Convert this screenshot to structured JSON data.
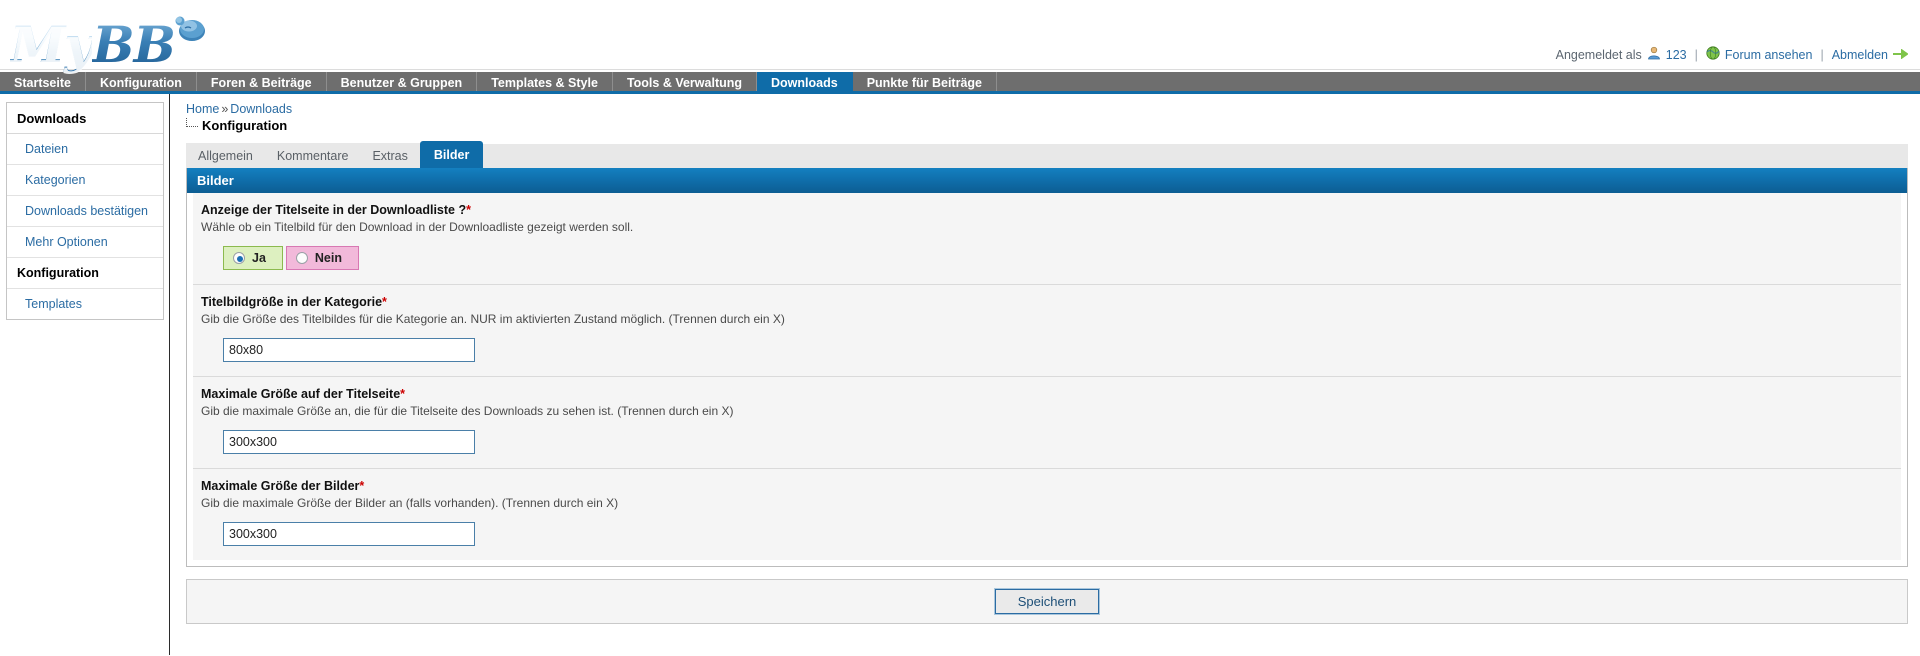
{
  "brand": {
    "my": "My",
    "bb": "BB",
    "bubble_icon": "speech-bubble-icon"
  },
  "userbar": {
    "logged_in_label": "Angemeldet als",
    "user_icon": "user-icon",
    "username": "123",
    "separator": "|",
    "globe_icon": "globe-icon",
    "forum_link": "Forum ansehen",
    "logout_link": "Abmelden",
    "logout_arrow_icon": "arrow-right-icon"
  },
  "nav": {
    "items": [
      {
        "label": "Startseite",
        "active": false
      },
      {
        "label": "Konfiguration",
        "active": false
      },
      {
        "label": "Foren & Beiträge",
        "active": false
      },
      {
        "label": "Benutzer & Gruppen",
        "active": false
      },
      {
        "label": "Templates & Style",
        "active": false
      },
      {
        "label": "Tools & Verwaltung",
        "active": false
      },
      {
        "label": "Downloads",
        "active": true
      },
      {
        "label": "Punkte für Beiträge",
        "active": false
      }
    ]
  },
  "sidebar": {
    "heading": "Downloads",
    "items": [
      {
        "label": "Dateien",
        "current": false
      },
      {
        "label": "Kategorien",
        "current": false
      },
      {
        "label": "Downloads bestätigen",
        "current": false
      },
      {
        "label": "Mehr Optionen",
        "current": false
      },
      {
        "label": "Konfiguration",
        "current": true
      },
      {
        "label": "Templates",
        "current": false
      }
    ]
  },
  "breadcrumb": {
    "home": "Home",
    "chevron": "»",
    "section": "Downloads",
    "current": "Konfiguration"
  },
  "tabs": [
    {
      "label": "Allgemein",
      "active": false
    },
    {
      "label": "Kommentare",
      "active": false
    },
    {
      "label": "Extras",
      "active": false
    },
    {
      "label": "Bilder",
      "active": true
    }
  ],
  "panel": {
    "title": "Bilder",
    "fields": [
      {
        "label": "Anzeige der Titelseite in der Downloadliste ?",
        "required": "*",
        "description": "Wähle ob ein Titelbild für den Download in der Downloadliste gezeigt werden soll.",
        "type": "radio",
        "options": [
          {
            "label": "Ja",
            "selected": true
          },
          {
            "label": "Nein",
            "selected": false
          }
        ]
      },
      {
        "label": "Titelbildgröße in der Kategorie",
        "required": "*",
        "description": "Gib die Größe des Titelbildes für die Kategorie an. NUR im aktivierten Zustand möglich. (Trennen durch ein X)",
        "type": "text",
        "value": "80x80"
      },
      {
        "label": "Maximale Größe auf der Titelseite",
        "required": "*",
        "description": "Gib die maximale Größe an, die für die Titelseite des Downloads zu sehen ist. (Trennen durch ein X)",
        "type": "text",
        "value": "300x300"
      },
      {
        "label": "Maximale Größe der Bilder",
        "required": "*",
        "description": "Gib die maximale Größe der Bilder an (falls vorhanden). (Trennen durch ein X)",
        "type": "text",
        "value": "300x300"
      }
    ]
  },
  "save": {
    "label": "Speichern"
  },
  "colors": {
    "accent_blue": "#0f6ca8",
    "nav_gray": "#6e6e6e",
    "link_blue": "#2b6ca3",
    "required_red": "#cc0000",
    "yes_green_bg": "#ddf0c0",
    "no_pink_bg": "#f2b9da"
  }
}
